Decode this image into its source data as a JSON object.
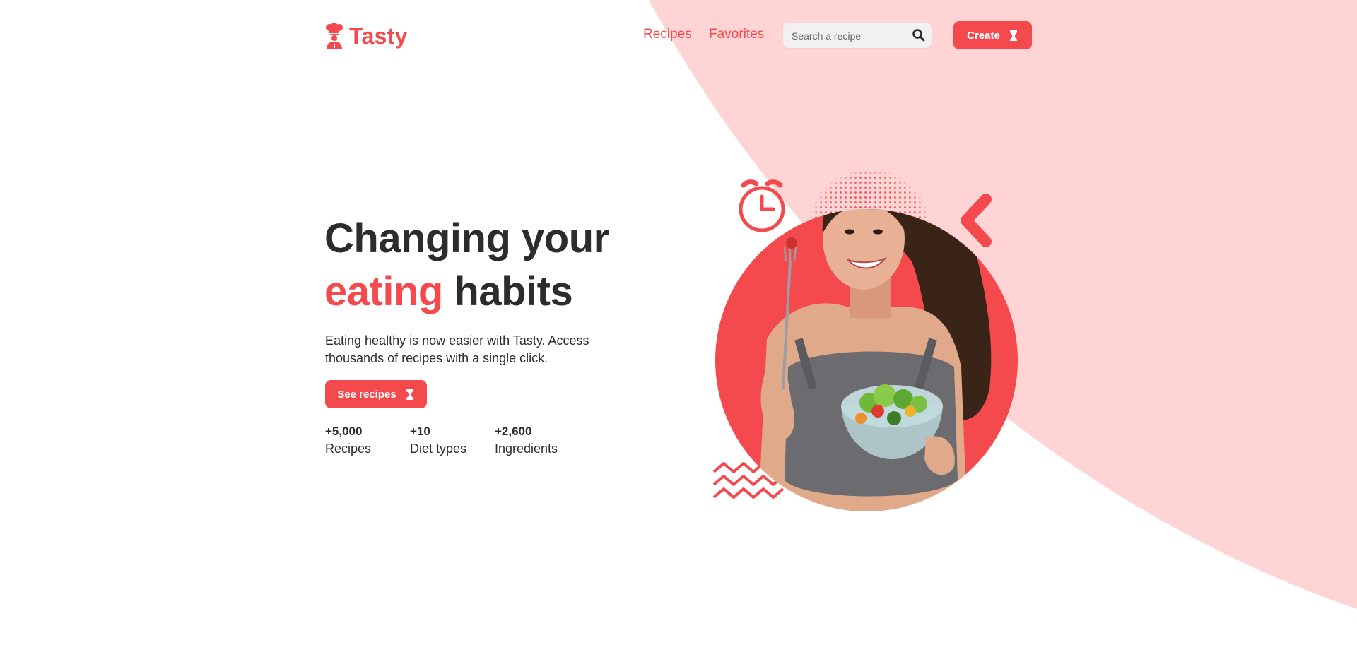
{
  "brand": {
    "name": "Tasty",
    "logo_icon": "chef-icon",
    "accent_color": "#f44a4e",
    "light_accent_color": "#ffd4d5",
    "text_color": "#2c2c2c"
  },
  "nav": {
    "items": [
      {
        "label": "Recipes"
      },
      {
        "label": "Favorites"
      }
    ]
  },
  "search": {
    "placeholder": "Search a recipe",
    "icon": "search-icon"
  },
  "header_button": {
    "label": "Create",
    "icon": "chef-icon"
  },
  "hero": {
    "title_line1": "Changing your",
    "title_accent": "eating",
    "title_rest": " habits",
    "description": "Eating healthy is now easier with Tasty. Access thousands of recipes with a single click.",
    "cta_label": "See recipes",
    "cta_icon": "chef-icon"
  },
  "stats": [
    {
      "value": "+5,000",
      "label": "Recipes"
    },
    {
      "value": "+10",
      "label": "Diet types"
    },
    {
      "value": "+2,600",
      "label": "Ingredients"
    }
  ],
  "illustration": {
    "icons": [
      "alarm-clock-icon",
      "chevron-left-icon",
      "zigzag-decoration",
      "dot-pattern"
    ]
  }
}
